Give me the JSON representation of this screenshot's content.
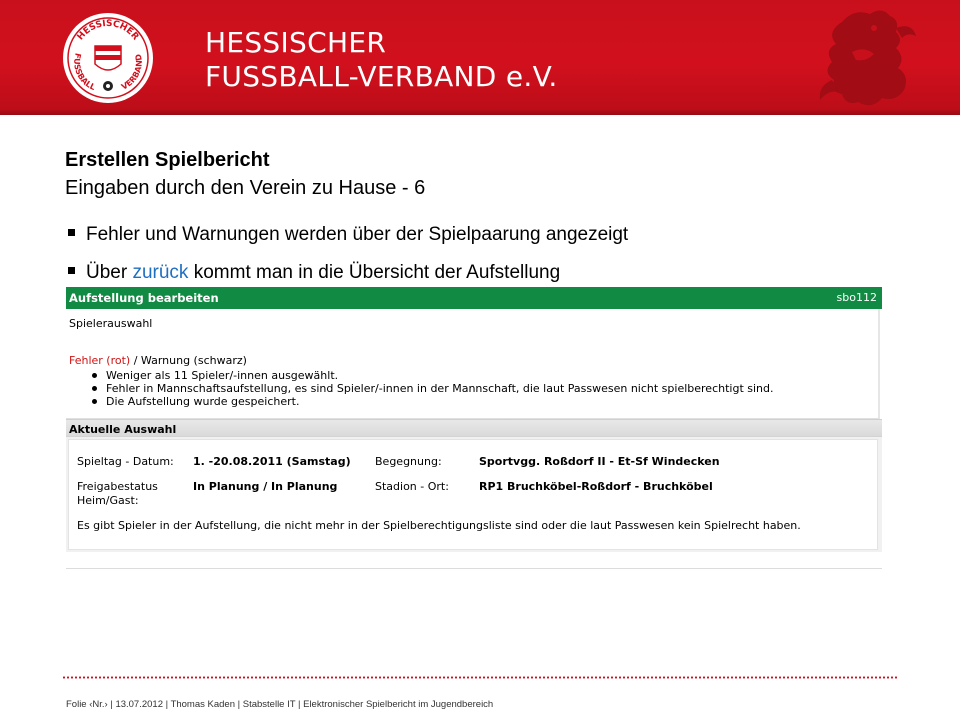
{
  "header": {
    "org_line1": "HESSISCHER",
    "org_line2": "FUSSBALL-VERBAND e.V.",
    "logo_text_top": "HESSISCHER",
    "logo_text_left": "FUSSBALL",
    "logo_text_right": "VERBAND",
    "brand_color": "#d2101d"
  },
  "slide": {
    "title": "Erstellen Spielbericht",
    "subtitle": "Eingaben durch den Verein zu Hause - 6",
    "bullet1": "Fehler und Warnungen werden über der Spielpaarung angezeigt",
    "bullet2_pre": "Über ",
    "bullet2_link": "zurück",
    "bullet2_post": " kommt man in die Übersicht der Aufstellung"
  },
  "panel": {
    "title": "Aufstellung bearbeiten",
    "code": "sbo112",
    "subheading": "Spielerauswahl",
    "legend_error": "Fehler (rot)",
    "legend_rest": " / Warnung (schwarz)",
    "messages": [
      "Weniger als 11 Spieler/-innen ausgewählt.",
      "Fehler in Mannschaftsaufstellung, es sind Spieler/-innen in der Mannschaft, die laut Passwesen nicht spielberechtigt sind.",
      "Die Aufstellung wurde gespeichert."
    ],
    "header_color": "#118a43"
  },
  "selection": {
    "title": "Aktuelle Auswahl",
    "spieltag_label": "Spieltag - Datum:",
    "spieltag_value": "1. -20.08.2011 (Samstag)",
    "begegnung_label": "Begegnung:",
    "begegnung_value": "Sportvgg. Roßdorf II - Et-Sf Windecken",
    "freigabe_label": "Freigabestatus",
    "freigabe_label2": "Heim/Gast:",
    "freigabe_value": "In Planung / In Planung",
    "stadion_label": "Stadion - Ort:",
    "stadion_value": "RP1 Bruchköbel-Roßdorf - Bruchköbel",
    "note": "Es gibt Spieler in der Aufstellung, die nicht mehr in der Spielberechtigungsliste sind oder die laut Passwesen kein Spielrecht haben."
  },
  "footer": {
    "text": "Folie ‹Nr.› | 13.07.2012 | Thomas Kaden | Stabstelle IT | Elektronischer Spielbericht im Jugendbereich"
  }
}
